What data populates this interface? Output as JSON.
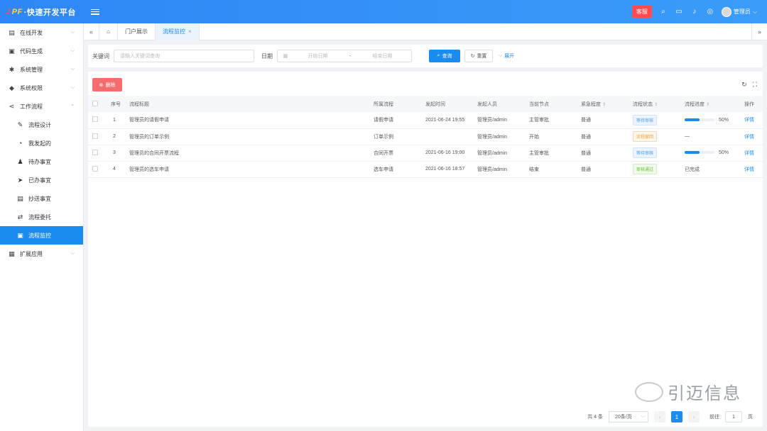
{
  "app": {
    "logo_mark": "J",
    "logo_mark2": "PF",
    "title": "·快速开发平台",
    "kf_badge": "客服",
    "user_name": "管理员"
  },
  "sidebar": {
    "items": [
      {
        "label": "在线开发",
        "icon": "grid-icon",
        "glyph": "▤",
        "chev": "⌵"
      },
      {
        "label": "代码生成",
        "icon": "code-icon",
        "glyph": "▣",
        "chev": "⌵"
      },
      {
        "label": "系统管理",
        "icon": "gear-icon",
        "glyph": "✱",
        "chev": "⌵"
      },
      {
        "label": "系统权限",
        "icon": "shield-icon",
        "glyph": "◆",
        "chev": "⌵"
      },
      {
        "label": "工作流程",
        "icon": "share-icon",
        "glyph": "⋖",
        "chev": "⌃"
      }
    ],
    "subitems": [
      {
        "label": "流程设计",
        "icon": "edit-icon",
        "glyph": "✎"
      },
      {
        "label": "我发起的",
        "icon": "clock-icon",
        "glyph": "◔"
      },
      {
        "label": "待办事宜",
        "icon": "user-icon",
        "glyph": "♟"
      },
      {
        "label": "已办事宜",
        "icon": "send-icon",
        "glyph": "➤"
      },
      {
        "label": "抄送事宜",
        "icon": "doc-icon",
        "glyph": "▤"
      },
      {
        "label": "流程委托",
        "icon": "delegate-icon",
        "glyph": "⇄"
      },
      {
        "label": "流程监控",
        "icon": "monitor-icon",
        "glyph": "▣"
      }
    ],
    "extra": {
      "label": "扩展应用",
      "icon": "apps-icon",
      "glyph": "▦",
      "chev": "⌵"
    }
  },
  "tabs": {
    "left_nav": "«",
    "right_nav": "»",
    "home_glyph": "⌂",
    "items": [
      {
        "label": "门户展示"
      },
      {
        "label": "流程监控",
        "close": "×"
      }
    ]
  },
  "search": {
    "keyword_label": "关键词",
    "keyword_placeholder": "请输入关键词查询",
    "date_label": "日期",
    "date_start": "开始日期",
    "date_sep": "-",
    "date_end": "结束日期",
    "search_btn": "查询",
    "reset_btn": "重置",
    "expand_btn": "展开"
  },
  "toolbar": {
    "delete_btn": "删除"
  },
  "table": {
    "headers": [
      "",
      "序号",
      "流程标题",
      "所属流程",
      "发起时间",
      "发起人员",
      "当前节点",
      "紧急程度",
      "流程状态",
      "流程进度",
      "操作"
    ],
    "rows": [
      {
        "idx": "1",
        "title": "管理员的请假申请",
        "flow": "请假申请",
        "time": "2021-06-24 19:55",
        "starter": "管理员/admin",
        "node": "主管审批",
        "urgency": "普通",
        "status": "等待审核",
        "status_type": "pending",
        "progress": 0.5,
        "progress_text": "50%",
        "op": "详情"
      },
      {
        "idx": "2",
        "title": "管理员的订单示例",
        "flow": "订单示例",
        "time": "",
        "starter": "管理员/admin",
        "node": "开始",
        "urgency": "普通",
        "status": "流程撤回",
        "status_type": "rejected",
        "progress": null,
        "progress_text": "—",
        "op": "详情"
      },
      {
        "idx": "3",
        "title": "管理员的合同开票流程",
        "flow": "合同开票",
        "time": "2021-06-16 19:00",
        "starter": "管理员/admin",
        "node": "主管审批",
        "urgency": "普通",
        "status": "等待审核",
        "status_type": "pending",
        "progress": 0.5,
        "progress_text": "50%",
        "op": "详情"
      },
      {
        "idx": "4",
        "title": "管理员的选车申请",
        "flow": "选车申请",
        "time": "2021-06-16 18:57",
        "starter": "管理员/admin",
        "node": "结束",
        "urgency": "普通",
        "status": "审核通过",
        "status_type": "passed",
        "progress": null,
        "progress_text": "已完成",
        "op": "详情"
      }
    ]
  },
  "pager": {
    "total": "共 4 条",
    "size": "20条/页",
    "prev": "‹",
    "current": "1",
    "next": "›",
    "goto_prefix": "前往",
    "goto_value": "1",
    "goto_suffix": "页"
  },
  "watermark": {
    "text": "引迈信息"
  },
  "colors": {
    "primary": "#1a8cf0",
    "danger": "#f56c6c",
    "topbar": "#2f86f6"
  }
}
